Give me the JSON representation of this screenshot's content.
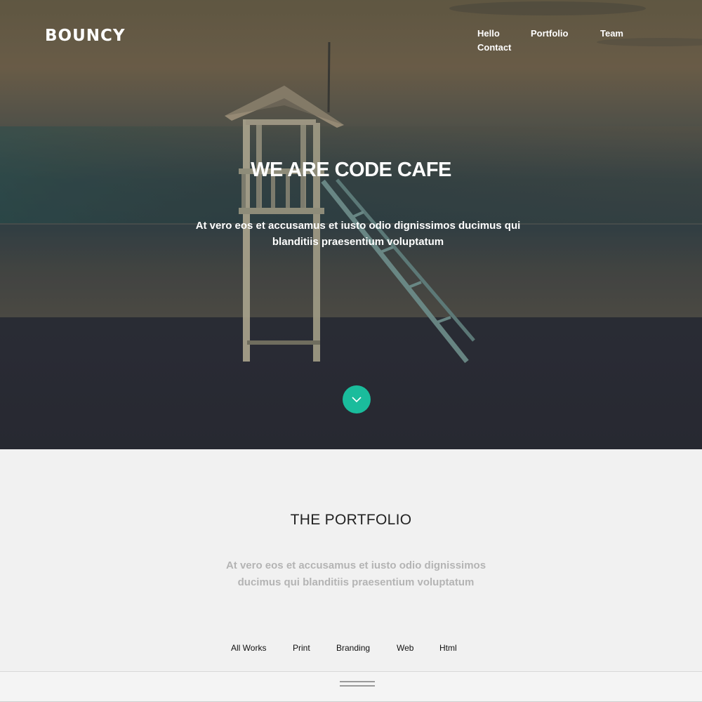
{
  "brand": {
    "logo": "BOUNCY"
  },
  "nav": {
    "items": [
      {
        "label": "Hello"
      },
      {
        "label": "Portfolio"
      },
      {
        "label": "Team"
      },
      {
        "label": "Contact"
      }
    ]
  },
  "hero": {
    "title": "WE ARE CODE CAFE",
    "subtitle": "At vero eos et accusamus et iusto odio dignissimos ducimus qui blanditiis praesentium voluptatum",
    "scroll_icon": "chevron-down-icon",
    "accent_color": "#1abc9c"
  },
  "portfolio": {
    "title": "THE PORTFOLIO",
    "subtitle": "At vero eos et accusamus et iusto odio dignissimos ducimus qui blanditiis praesentium voluptatum",
    "filters": [
      {
        "label": "All Works"
      },
      {
        "label": "Print"
      },
      {
        "label": "Branding"
      },
      {
        "label": "Web"
      },
      {
        "label": "Html"
      }
    ],
    "handle_icon": "drag-handle-icon"
  }
}
